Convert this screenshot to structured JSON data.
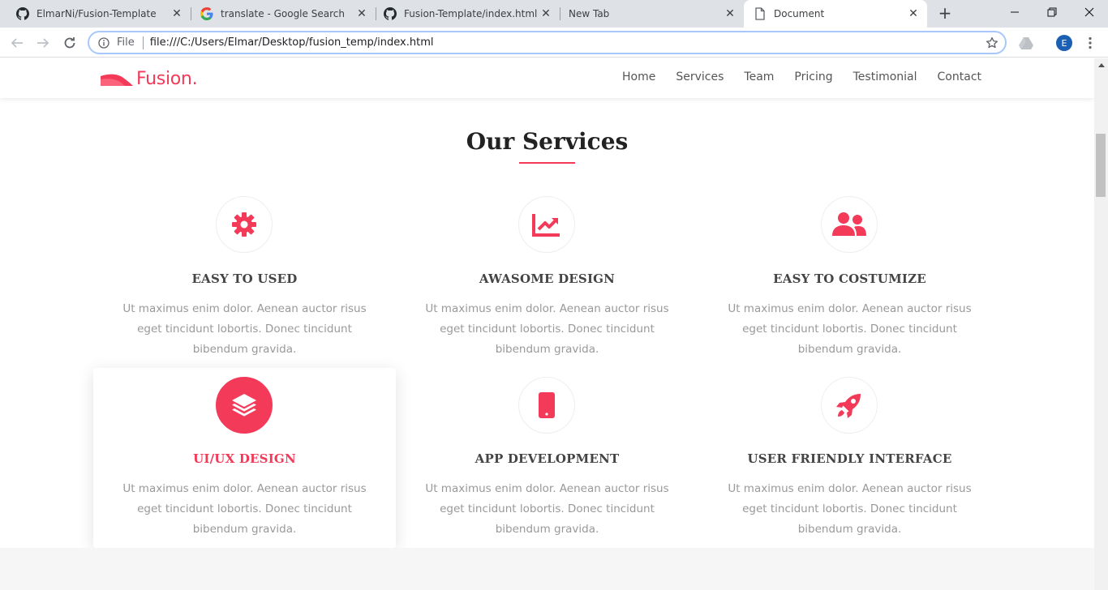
{
  "browser": {
    "tabs": [
      {
        "title": "ElmarNi/Fusion-Template",
        "icon": "github-icon",
        "active": false
      },
      {
        "title": "translate - Google Search",
        "icon": "google-icon",
        "active": false
      },
      {
        "title": "Fusion-Template/index.html at",
        "icon": "github-icon",
        "active": false
      },
      {
        "title": "New Tab",
        "icon": "",
        "active": false
      },
      {
        "title": "Document",
        "icon": "document-icon",
        "active": true
      }
    ],
    "address": {
      "scheme_label": "File",
      "url": "file:///C:/Users/Elmar/Desktop/fusion_temp/index.html"
    },
    "profile_initial": "E"
  },
  "site": {
    "logo_text": "Fusion.",
    "nav": [
      "Home",
      "Services",
      "Team",
      "Pricing",
      "Testimonial",
      "Contact"
    ],
    "section_title": "Our Services",
    "accent_color": "#f43a59",
    "services": [
      {
        "title": "EASY TO USED",
        "icon": "gear-icon",
        "text": "Ut maximus enim dolor. Aenean auctor risus eget tincidunt lobortis. Donec tincidunt bibendum gravida."
      },
      {
        "title": "AWASOME DESIGN",
        "icon": "chart-line-icon",
        "text": "Ut maximus enim dolor. Aenean auctor risus eget tincidunt lobortis. Donec tincidunt bibendum gravida."
      },
      {
        "title": "EASY TO COSTUMIZE",
        "icon": "users-icon",
        "text": "Ut maximus enim dolor. Aenean auctor risus eget tincidunt lobortis. Donec tincidunt bibendum gravida."
      },
      {
        "title": "UI/UX DESIGN",
        "icon": "layers-icon",
        "text": "Ut maximus enim dolor. Aenean auctor risus eget tincidunt lobortis. Donec tincidunt bibendum gravida.",
        "highlighted": true
      },
      {
        "title": "APP DEVELOPMENT",
        "icon": "mobile-icon",
        "text": "Ut maximus enim dolor. Aenean auctor risus eget tincidunt lobortis. Donec tincidunt bibendum gravida."
      },
      {
        "title": "USER FRIENDLY INTERFACE",
        "icon": "rocket-icon",
        "text": "Ut maximus enim dolor. Aenean auctor risus eget tincidunt lobortis. Donec tincidunt bibendum gravida."
      }
    ]
  }
}
